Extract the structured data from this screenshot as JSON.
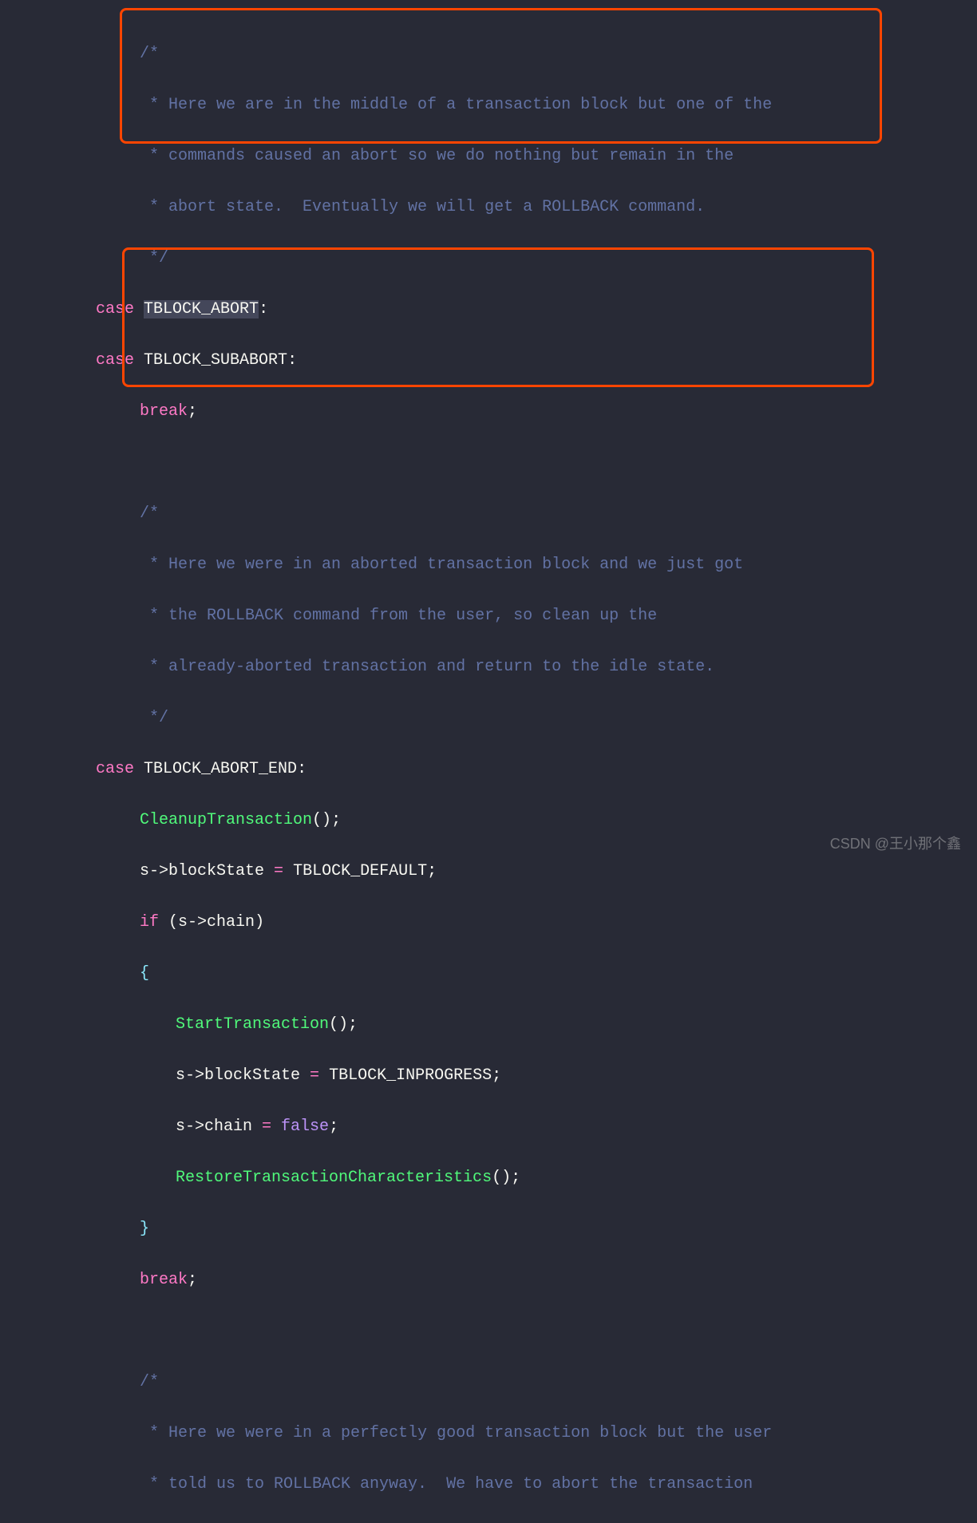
{
  "code": {
    "comment1_l1": "/*",
    "comment1_l2": " * Here we are in the middle of a transaction block but one of the",
    "comment1_l3": " * commands caused an abort so we do nothing but remain in the",
    "comment1_l4": " * abort state.  Eventually we will get a ROLLBACK command.",
    "comment1_l5": " */",
    "case_kw": "case",
    "tblock_abort": "TBLOCK_ABORT",
    "tblock_subabort": "TBLOCK_SUBABORT",
    "break_kw": "break",
    "colon": ":",
    "semi": ";",
    "comment2_l1": "/*",
    "comment2_l2": " * Here we were in an aborted transaction block and we just got",
    "comment2_l3": " * the ROLLBACK command from the user, so clean up the",
    "comment2_l4": " * already-aborted transaction and return to the idle state.",
    "comment2_l5": " */",
    "tblock_abort_end": "TBLOCK_ABORT_END",
    "cleanup_fn": "CleanupTransaction",
    "parens": "()",
    "s_arrow": "s->",
    "blockstate": "blockState",
    "eq": " = ",
    "tblock_default": "TBLOCK_DEFAULT",
    "if_kw": "if",
    "lparen": " (",
    "chain": "chain",
    "rparen": ")",
    "lbrace": "{",
    "rbrace": "}",
    "start_fn": "StartTransaction",
    "tblock_inprogress": "TBLOCK_INPROGRESS",
    "false_kw": "false",
    "restore_fn": "RestoreTransactionCharacteristics",
    "comment3_l1": "/*",
    "comment3_l2": " * Here we were in a perfectly good transaction block but the user",
    "comment3_l3": " * told us to ROLLBACK anyway.  We have to abort the transaction"
  },
  "watermark": "CSDN @王小那个鑫"
}
